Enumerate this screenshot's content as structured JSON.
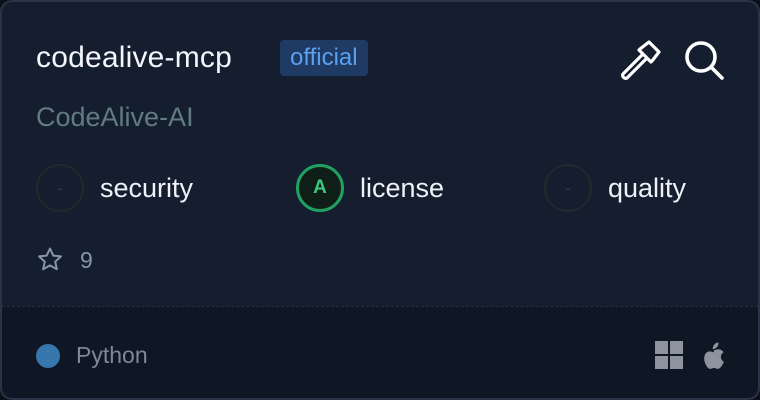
{
  "card": {
    "title": "codealive-mcp",
    "badge": "official",
    "author": "CodeAlive-AI",
    "header_icons": [
      "hammer-icon",
      "search-icon"
    ],
    "metrics": [
      {
        "grade": "-",
        "label": "security"
      },
      {
        "grade": "A",
        "label": "license"
      },
      {
        "grade": "-",
        "label": "quality"
      }
    ],
    "stars": "9",
    "language": {
      "name": "Python",
      "color": "#3777ae"
    },
    "platforms": [
      "windows-icon",
      "apple-icon"
    ],
    "colors": {
      "background": "#151e2f",
      "footer": "#101724",
      "badge_bg": "#1f3b63",
      "badge_text": "#5aa0ef",
      "grade_a": "#22a062",
      "author": "#617b80"
    }
  }
}
